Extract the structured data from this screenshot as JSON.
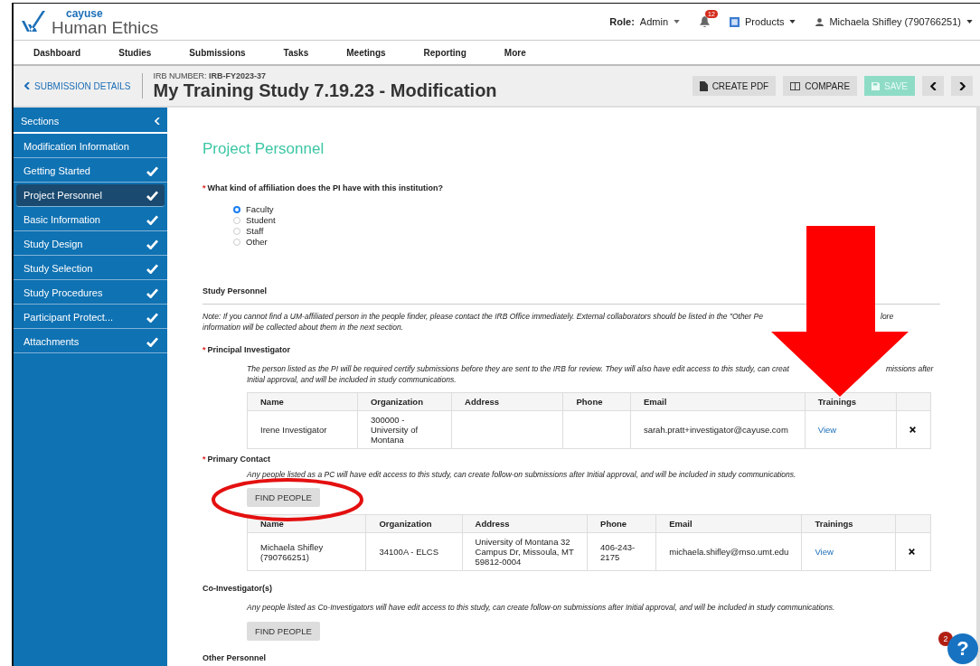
{
  "header": {
    "logo_top": "cayuse",
    "logo_bottom": "Human Ethics",
    "role_label": "Role:",
    "role_value": "Admin",
    "notifications": "12",
    "products": "Products",
    "user": "Michaela Shifley (790766251)"
  },
  "nav": [
    "Dashboard",
    "Studies",
    "Submissions",
    "Tasks",
    "Meetings",
    "Reporting",
    "More"
  ],
  "subheader": {
    "back": "SUBMISSION DETAILS",
    "irb_number": "IRB NUMBER: **IRB-FY2023-37**",
    "title": "My Training Study 7.19.23 - Modification",
    "buttons": [
      {
        "label": "CREATE PDF",
        "kind": "pdf",
        "disabled": false
      },
      {
        "label": "COMPARE",
        "kind": "compare",
        "disabled": false
      },
      {
        "label": "SAVE",
        "kind": "save",
        "disabled": true
      }
    ]
  },
  "sidebar": {
    "title": "Sections",
    "items": [
      {
        "label": "Modification Information",
        "checked": false,
        "selected": false
      },
      {
        "label": "Getting Started",
        "checked": true,
        "selected": false
      },
      {
        "label": "Project Personnel",
        "checked": true,
        "selected": true
      },
      {
        "label": "Basic Information",
        "checked": true,
        "selected": false
      },
      {
        "label": "Study Design",
        "checked": true,
        "selected": false
      },
      {
        "label": "Study Selection",
        "checked": true,
        "selected": false
      },
      {
        "label": "Study Procedures",
        "checked": true,
        "selected": false
      },
      {
        "label": "Participant Protect...",
        "checked": true,
        "selected": false
      },
      {
        "label": "Attachments",
        "checked": true,
        "selected": false
      }
    ]
  },
  "page_title": "Project Personnel",
  "question": {
    "required_mark": "*",
    "label": "What kind of affiliation does the PI have with this institution?",
    "options": [
      {
        "label": "Faculty",
        "selected": true
      },
      {
        "label": "Student",
        "selected": false
      },
      {
        "label": "Staff",
        "selected": false
      },
      {
        "label": "Other",
        "selected": false
      }
    ]
  },
  "study_personnel": {
    "heading": "Study Personnel",
    "note_line_1": [
      "Note: If you cannot find a UM-affiliated person in the people finder, please contact the IRB Office immediately. External collaborators should be listed in the \"Other Pe",
      "lore"
    ],
    "note_line_2": "information will be collected about them in the next section."
  },
  "principal_investigator": {
    "required_mark": "*",
    "heading": "Principal Investigator",
    "description_line_1": [
      "The person listed as the PI will be required certify submissions before they are sent to the IRB for review. They will also have edit access to this study, can creat",
      "missions after"
    ],
    "description_line_2": "Initial approval, and will be included in study communications.",
    "columns": [
      "Name",
      "Organization",
      "Address",
      "Phone",
      "Email",
      "Trainings"
    ],
    "rows": [
      {
        "name": "Irene Investigator",
        "organization": "300000 - University of Montana",
        "address": "",
        "phone": "",
        "email": "sarah.pratt+investigator@cayuse.com",
        "trainings": "View"
      }
    ]
  },
  "primary_contact": {
    "required_mark": "*",
    "heading": "Primary Contact",
    "description": "Any people listed as a PC will have edit access to this study, can create follow-on submissions after Initial approval, and will be included in study communications.",
    "button": "FIND PEOPLE",
    "columns": [
      "Name",
      "Organization",
      "Address",
      "Phone",
      "Email",
      "Trainings"
    ],
    "rows": [
      {
        "name": "Michaela Shifley (790766251)",
        "organization": "34100A - ELCS",
        "address": "University of Montana 32 Campus Dr, Missoula, MT 59812-0004",
        "phone": "406-243-2175",
        "email": "michaela.shifley@mso.umt.edu",
        "trainings": "View"
      }
    ]
  },
  "co_investigators": {
    "heading": "Co-Investigator(s)",
    "description": "Any people listed as Co-Investigators will have edit access to this study, can create follow-on submissions after Initial approval, and will be included in study communications.",
    "button": "FIND PEOPLE"
  },
  "other_personnel": {
    "heading": "Other Personnel"
  },
  "help": {
    "label": "?",
    "badge": "2"
  }
}
